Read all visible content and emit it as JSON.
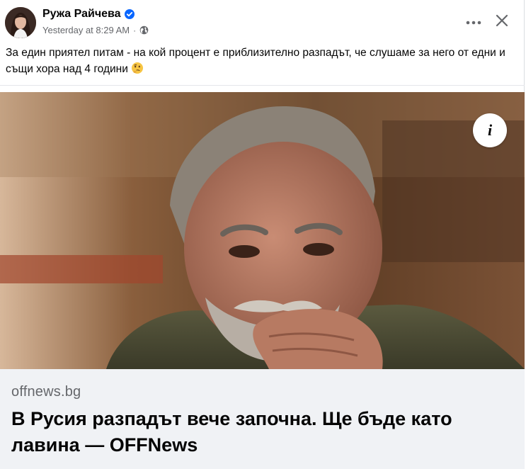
{
  "post": {
    "author_name": "Ружа Райчева",
    "verified": true,
    "timestamp": "Yesterday at 8:29 AM",
    "separator": "·",
    "audience_icon": "globe-icon",
    "text": "За един приятел питам - на кой процент е приблизително разпадът, че слушаме за него от едни и същи хора над 4 години",
    "emoji_icon": "thinking-face-icon"
  },
  "actions": {
    "more_icon": "more-horizontal-icon",
    "close_icon": "close-icon"
  },
  "link_preview": {
    "domain": "offnews.bg",
    "title": "В Русия разпадът вече започна. Ще бъде като лавина — OFFNews",
    "info_label": "i"
  },
  "colors": {
    "verified_blue": "#0866ff",
    "secondary_text": "#65676b",
    "card_background": "#f0f2f5"
  }
}
